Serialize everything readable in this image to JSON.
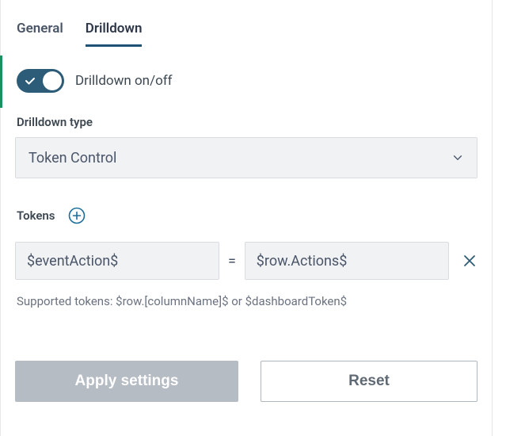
{
  "tabs": {
    "general": "General",
    "drilldown": "Drilldown"
  },
  "toggle": {
    "label": "Drilldown on/off"
  },
  "type_section": {
    "label": "Drilldown type",
    "value": "Token Control"
  },
  "tokens_section": {
    "label": "Tokens",
    "row": {
      "left": "$eventAction$",
      "equals": "=",
      "right": "$row.Actions$"
    },
    "help": "Supported tokens: $row.[columnName]$ or $dashboardToken$"
  },
  "buttons": {
    "apply": "Apply settings",
    "reset": "Reset"
  }
}
